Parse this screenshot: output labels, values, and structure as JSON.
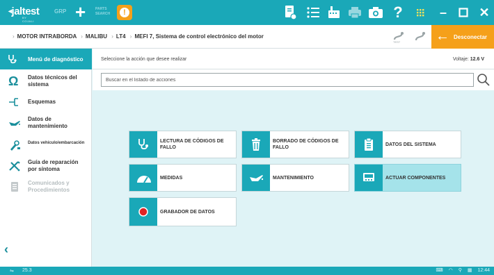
{
  "topbar": {
    "logo_text": "jaltest",
    "logo_sub": "BY COJALI",
    "grp_label": "GRP",
    "parts_line1": "PARTS",
    "parts_line2": "SEARCH",
    "alert_glyph": "!",
    "accent_color": "#1aa8b8",
    "alert_color": "#f5a01a"
  },
  "breadcrumb": {
    "items": [
      "MOTOR INTRABORDA",
      "MALIBU",
      "LT4",
      "MEFI 7, Sistema de control electrónico del motor"
    ]
  },
  "disconnect": {
    "label": "Desconectar"
  },
  "sidebar": {
    "items": [
      {
        "label": "Menú de diagnóstico",
        "icon": "stethoscope-icon",
        "active": true
      },
      {
        "label": "Datos técnicos del sistema",
        "icon": "omega-icon"
      },
      {
        "label": "Esquemas",
        "icon": "schematic-icon"
      },
      {
        "label": "Datos de mantenimiento",
        "icon": "oil-can-icon"
      },
      {
        "label": "Datos vehículo/embarcación",
        "icon": "wrench-vehicle-icon"
      },
      {
        "label": "Guía de reparación por síntoma",
        "icon": "tools-icon"
      },
      {
        "label": "Comunicados y Procedimientos",
        "icon": "document-icon",
        "disabled": true
      }
    ]
  },
  "main": {
    "prompt": "Seleccione la acción que desee realizar",
    "voltage_label": "Voltaje:",
    "voltage_value": "12.6 V",
    "search_placeholder": "Buscar en el listado de acciones"
  },
  "actions": [
    {
      "label": "LECTURA DE CÓDIGOS DE FALLO",
      "icon": "stethoscope-icon"
    },
    {
      "label": "BORRADO DE CÓDIGOS DE FALLO",
      "icon": "trash-icon"
    },
    {
      "label": "DATOS DEL SISTEMA",
      "icon": "clipboard-icon"
    },
    {
      "label": "MEDIDAS",
      "icon": "gauge-icon"
    },
    {
      "label": "MANTENIMIENTO",
      "icon": "oil-can-icon"
    },
    {
      "label": "ACTUAR COMPONENTES",
      "icon": "component-icon",
      "highlighted": true
    },
    {
      "label": "GRABADOR DE DATOS",
      "icon": "record-icon"
    }
  ],
  "statusbar": {
    "version": "25.3",
    "time": "12:44"
  }
}
